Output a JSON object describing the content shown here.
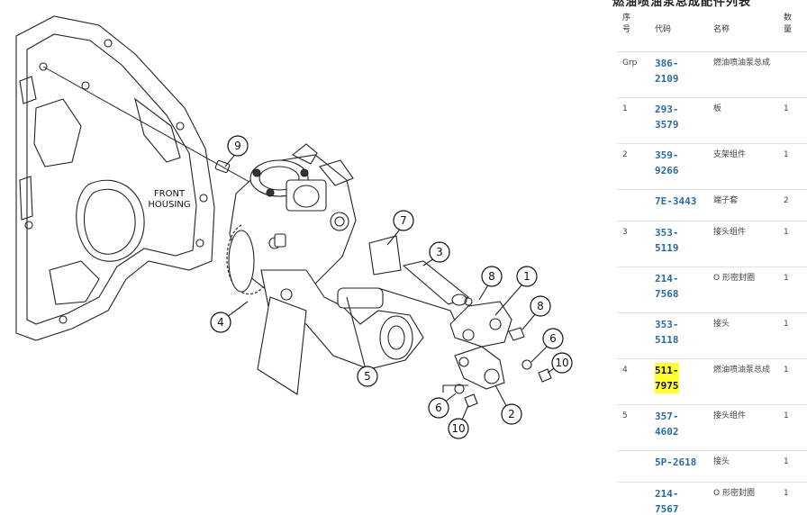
{
  "diagram": {
    "housing_label_line1": "FRONT",
    "housing_label_line2": "HOUSING",
    "callouts": [
      "9",
      "7",
      "3",
      "8",
      "1",
      "8",
      "4",
      "5",
      "6",
      "10",
      "2",
      "6",
      "10"
    ]
  },
  "panel": {
    "title": "燃油喷油泵总成配件列表",
    "headers": {
      "no_1": "序",
      "no_2": "号",
      "code": "代码",
      "name": "名称",
      "qty_1": "数",
      "qty_2": "量"
    },
    "rows": [
      {
        "no": "Grp",
        "code_1": "386-",
        "code_2": "2109",
        "name": "燃油喷油泵总成",
        "qty": ""
      },
      {
        "no": "1",
        "code_1": "293-",
        "code_2": "3579",
        "name": "板",
        "qty": "1"
      },
      {
        "no": "2",
        "code_1": "359-",
        "code_2": "9266",
        "name": "支架组件",
        "qty": "1"
      },
      {
        "no": "",
        "code_1": "7E-3443",
        "code_2": "",
        "name": "端子套",
        "qty": "2"
      },
      {
        "no": "3",
        "code_1": "353-",
        "code_2": "5119",
        "name": "接头组件",
        "qty": "1"
      },
      {
        "no": "",
        "code_1": "214-",
        "code_2": "7568",
        "name": "O 形密封圈",
        "qty": "1"
      },
      {
        "no": "",
        "code_1": "353-",
        "code_2": "5118",
        "name": "接头",
        "qty": "1"
      },
      {
        "no": "4",
        "code_1": "511-",
        "code_2": "7975",
        "name": "燃油喷油泵总成",
        "qty": "1",
        "highlight": true
      },
      {
        "no": "5",
        "code_1": "357-",
        "code_2": "4602",
        "name": "接头组件",
        "qty": "1"
      },
      {
        "no": "",
        "code_1": "5P-2618",
        "code_2": "",
        "name": "接头",
        "qty": "1"
      },
      {
        "no": "",
        "code_1": "214-",
        "code_2": "7567",
        "name": "O 形密封圈",
        "qty": "1"
      }
    ]
  },
  "colors": {
    "link": "#2a6aa5",
    "highlight": "#ffff33"
  }
}
